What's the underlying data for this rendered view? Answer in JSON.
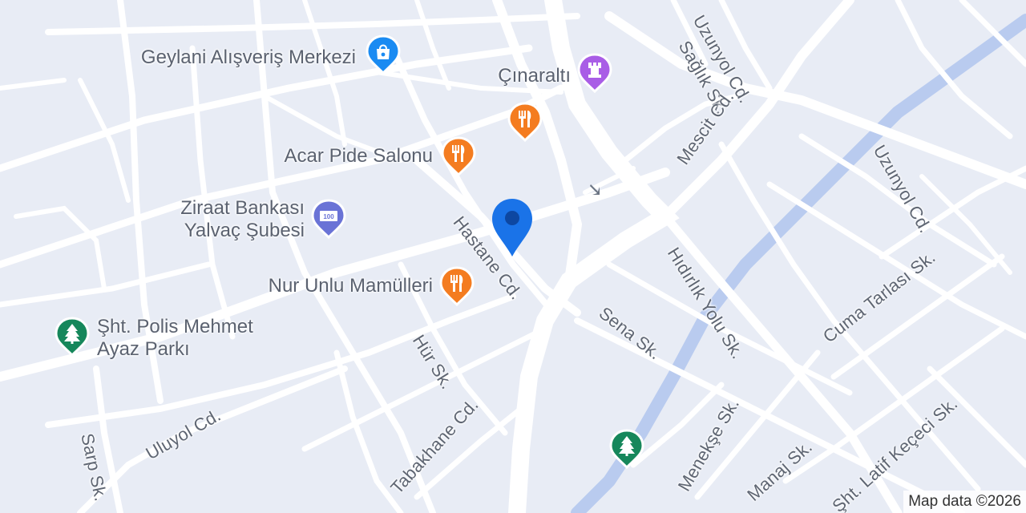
{
  "map": {
    "colors": {
      "background": "#e8ecf5",
      "road": "#ffffff",
      "water": "#b9cbef",
      "food": "#f47c20",
      "shopping": "#1a8bf2",
      "landmark": "#a95de6",
      "bank": "#6a73d6",
      "park": "#16875b",
      "location": "#1a73e8"
    },
    "pois": [
      {
        "id": "geylani",
        "name": "Geylani Alışveriş Merkezi",
        "category": "shopping",
        "icon": "shopping-bag-icon"
      },
      {
        "id": "cinaralti",
        "name": "Çınaraltı",
        "category": "landmark",
        "icon": "tower-icon"
      },
      {
        "id": "restaurant-unnamed",
        "name": "",
        "category": "food",
        "icon": "fork-knife-icon"
      },
      {
        "id": "acar",
        "name": "Acar Pide Salonu",
        "category": "food",
        "icon": "fork-knife-icon"
      },
      {
        "id": "ziraat",
        "name_line1": "Ziraat Bankası",
        "name_line2": "Yalvaç Şubesi",
        "category": "bank",
        "icon": "bank-100-icon"
      },
      {
        "id": "nur",
        "name": "Nur Unlu Mamülleri",
        "category": "food",
        "icon": "fork-knife-icon"
      },
      {
        "id": "park-polis",
        "name_line1": "Şht. Polis Mehmet",
        "name_line2": "Ayaz Parkı",
        "category": "park",
        "icon": "tree-icon"
      },
      {
        "id": "park-unnamed",
        "name": "",
        "category": "park",
        "icon": "tree-icon"
      }
    ],
    "streets": {
      "uzunyol_top": "Uzunyol Cd.",
      "saglik": "Sağlık Sk.",
      "mescit": "Mescit Cd.",
      "uzunyol_right": "Uzunyol Cd.",
      "hastane": "Hastane Cd.",
      "hidirlik": "Hıdırlık Yolu Sk.",
      "sena": "Sena Sk.",
      "cuma": "Cuma Tarlası Sk.",
      "hur": "Hür Sk.",
      "uluyol": "Uluyol Cd.",
      "sarp": "Sarp Sk.",
      "tabakhane": "Tabakhane Cd.",
      "menekse": "Menekşe Sk.",
      "manaj": "Manaj Sk.",
      "latif": "Şht. Latif Keçeci Sk."
    },
    "attribution": "Map data ©2026"
  }
}
